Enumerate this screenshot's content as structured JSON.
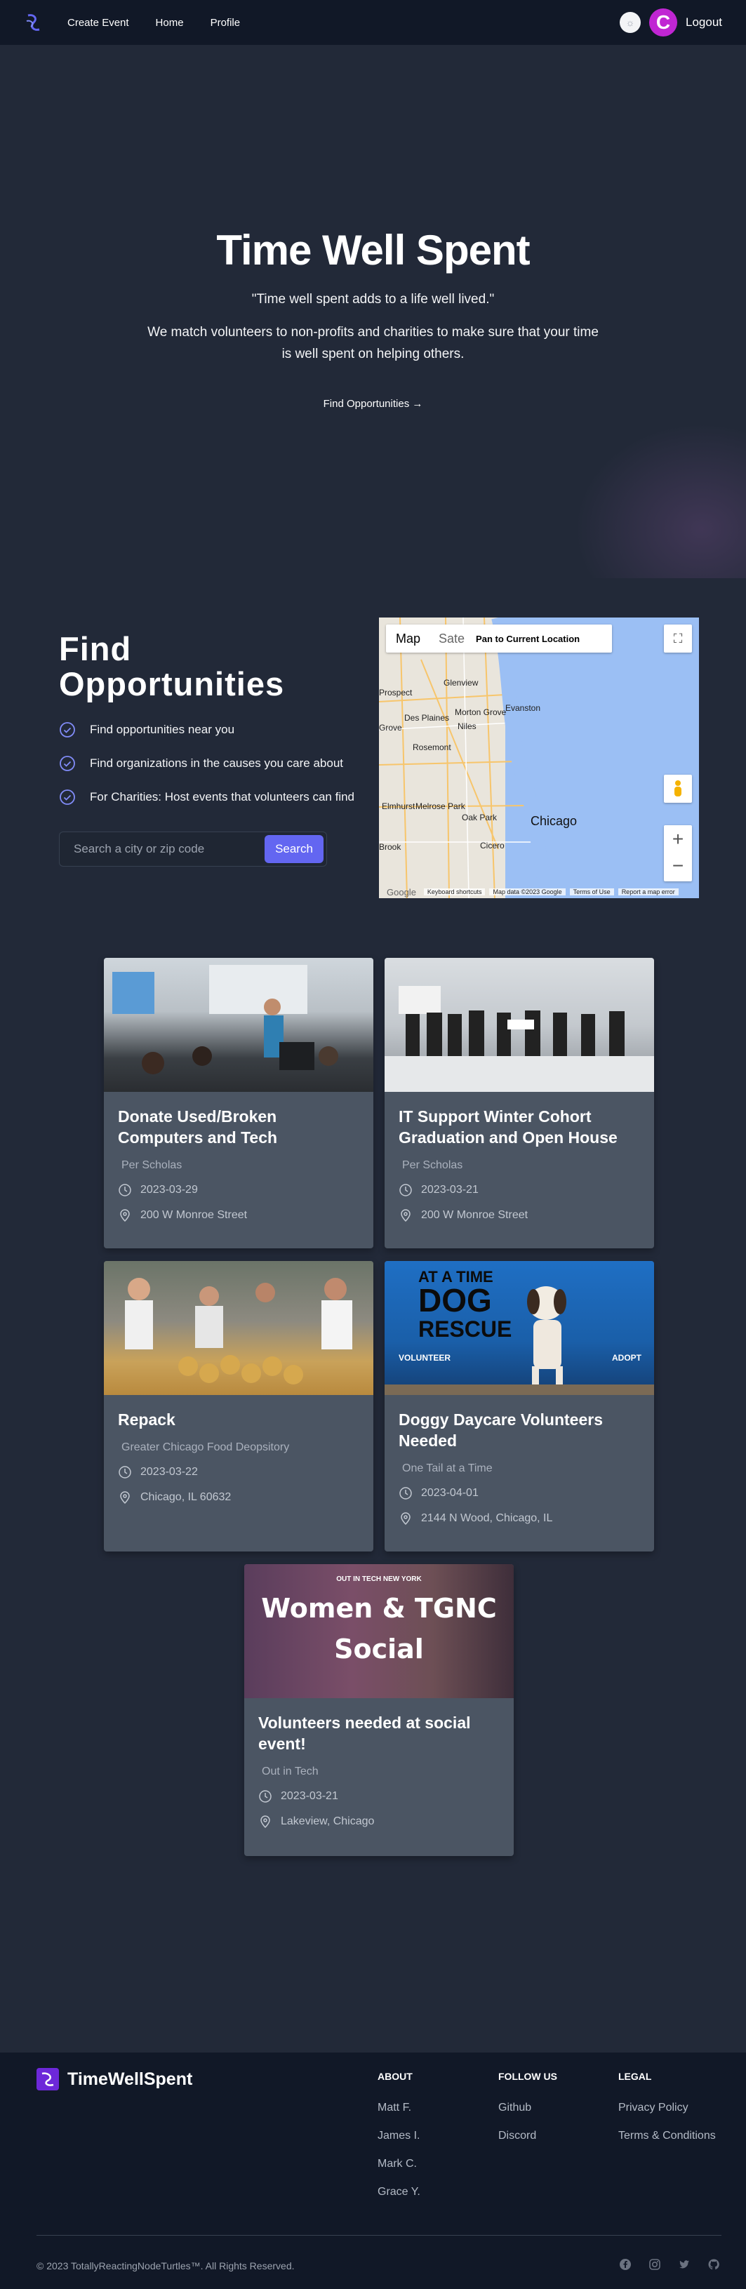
{
  "nav": {
    "links": [
      "Create Event",
      "Home",
      "Profile"
    ],
    "avatar_letter": "C",
    "logout_label": "Logout"
  },
  "hero": {
    "title": "Time Well Spent",
    "quote": "\"Time well spent adds to a life well lived.\"",
    "description": "We match volunteers to non-profits and charities to make sure that your time is well spent on helping others.",
    "cta": "Find Opportunities →"
  },
  "find": {
    "title_line1": "Find",
    "title_line2": "Opportunities",
    "features": [
      "Find opportunities near you",
      "Find organizations in the causes you care about",
      "For Charities: Host events that volunteers can find"
    ],
    "search_placeholder": "Search a city or zip code",
    "search_button": "Search"
  },
  "map": {
    "type_map": "Map",
    "type_satellite": "Sate",
    "pan_button": "Pan to Current Location",
    "places": [
      "Glenview",
      "Morton Grove",
      "Evanston",
      "Des Plaines",
      "Niles",
      "Rosemont",
      "Elmhurst",
      "Melrose Park",
      "Oak Park",
      "Cicero",
      "Chicago",
      "Prospect",
      "Grove",
      "Brook"
    ],
    "attribution": [
      "Keyboard shortcuts",
      "Map data ©2023 Google",
      "Terms of Use",
      "Report a map error"
    ],
    "logo": "Google"
  },
  "events": [
    {
      "title": "Donate Used/Broken Computers and Tech",
      "org": "Per Scholas",
      "date": "2023-03-29",
      "location": "200 W Monroe Street"
    },
    {
      "title": "IT Support Winter Cohort Graduation and Open House",
      "org": "Per Scholas",
      "date": "2023-03-21",
      "location": "200 W Monroe Street"
    },
    {
      "title": "Repack",
      "org": "Greater Chicago Food Deopsitory",
      "date": "2023-03-22",
      "location": "Chicago, IL 60632"
    },
    {
      "title": "Doggy Daycare Volunteers Needed",
      "org": "One Tail at a Time",
      "date": "2023-04-01",
      "location": "2144 N Wood, Chicago, IL"
    },
    {
      "title": "Volunteers needed at social event!",
      "org": "Out in Tech",
      "date": "2023-03-21",
      "location": "Lakeview, Chicago"
    }
  ],
  "event_images": {
    "dog_banner": [
      "AT A TIME",
      "DOG",
      "RESCUE"
    ],
    "dog_volunteer": "VOLUNTEER",
    "dog_adopt": "ADOPT",
    "social_header": "OUT IN TECH NEW YORK",
    "social_title": "Women & TGNC Social"
  },
  "footer": {
    "brand": "TimeWellSpent",
    "about_heading": "ABOUT",
    "about_links": [
      "Matt F.",
      "James I.",
      "Mark C.",
      "Grace Y."
    ],
    "follow_heading": "FOLLOW US",
    "follow_links": [
      "Github",
      "Discord"
    ],
    "legal_heading": "LEGAL",
    "legal_links": [
      "Privacy Policy",
      "Terms & Conditions"
    ],
    "copyright": "© 2023 TotallyReactingNodeTurtles™. All Rights Reserved.",
    "social_icons": [
      "facebook-icon",
      "instagram-icon",
      "twitter-icon",
      "github-icon"
    ]
  },
  "colors": {
    "background": "#222938",
    "nav": "#111827",
    "accent": "#6366f1",
    "avatar": "#c026d3",
    "card": "#4b5563"
  }
}
